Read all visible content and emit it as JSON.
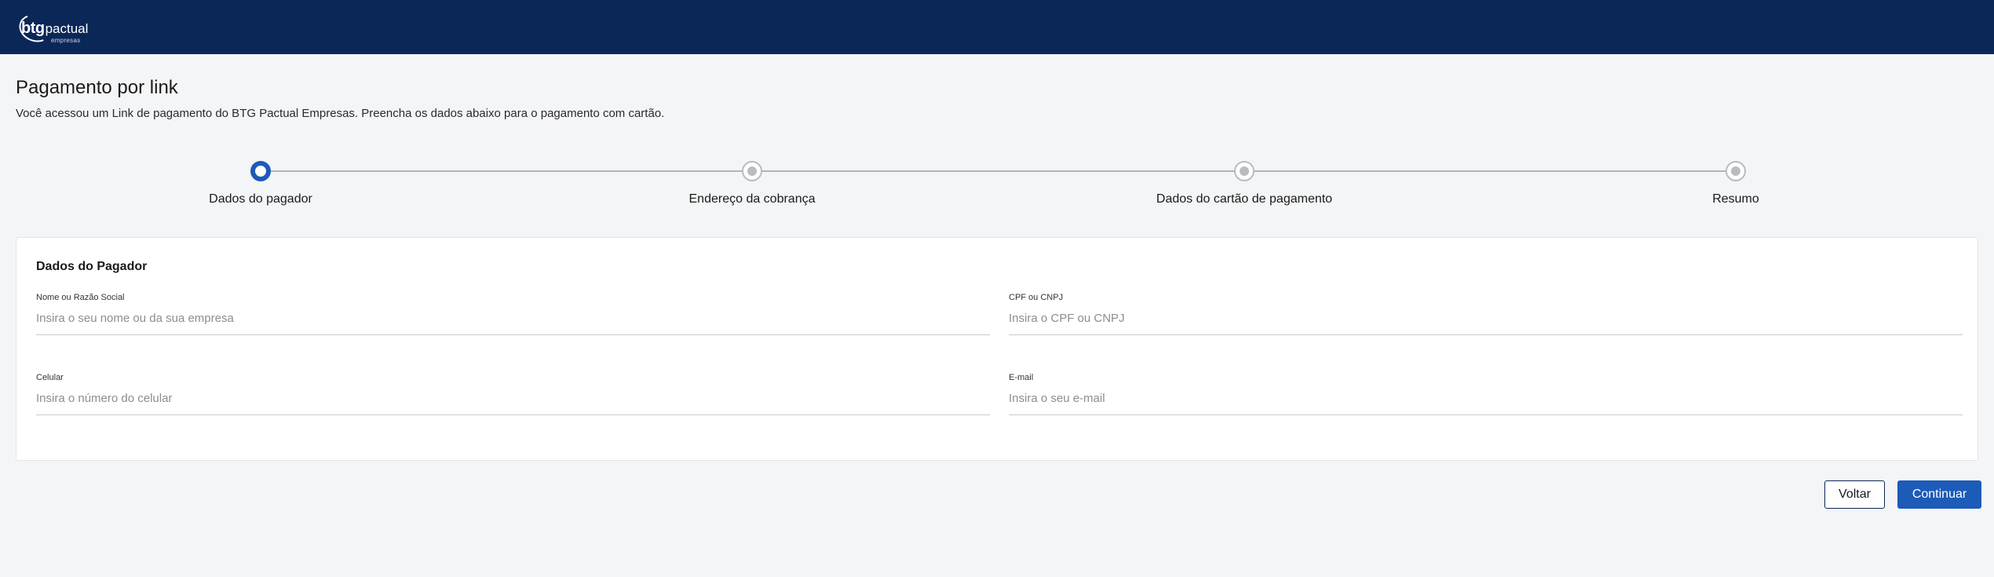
{
  "header": {
    "logo_btg": "btg",
    "logo_pactual": "pactual",
    "logo_sub": "empresas"
  },
  "page": {
    "title": "Pagamento por link",
    "subtitle": "Você acessou um Link de pagamento do BTG Pactual Empresas. Preencha os dados abaixo para o pagamento com cartão."
  },
  "stepper": {
    "steps": [
      {
        "label": "Dados do pagador",
        "active": true
      },
      {
        "label": "Endereço da cobrança",
        "active": false
      },
      {
        "label": "Dados do cartão de pagamento",
        "active": false
      },
      {
        "label": "Resumo",
        "active": false
      }
    ]
  },
  "form": {
    "title": "Dados do Pagador",
    "fields": {
      "name": {
        "label": "Nome ou Razão Social",
        "placeholder": "Insira o seu nome ou da sua empresa",
        "value": ""
      },
      "document": {
        "label": "CPF ou CNPJ",
        "placeholder": "Insira o CPF ou CNPJ",
        "value": ""
      },
      "phone": {
        "label": "Celular",
        "placeholder": "Insira o número do celular",
        "value": ""
      },
      "email": {
        "label": "E-mail",
        "placeholder": "Insira o seu e-mail",
        "value": ""
      }
    }
  },
  "actions": {
    "back_label": "Voltar",
    "continue_label": "Continuar"
  },
  "colors": {
    "header_bg": "#0b2758",
    "primary": "#1c5bb8",
    "background": "#f4f5f7"
  }
}
